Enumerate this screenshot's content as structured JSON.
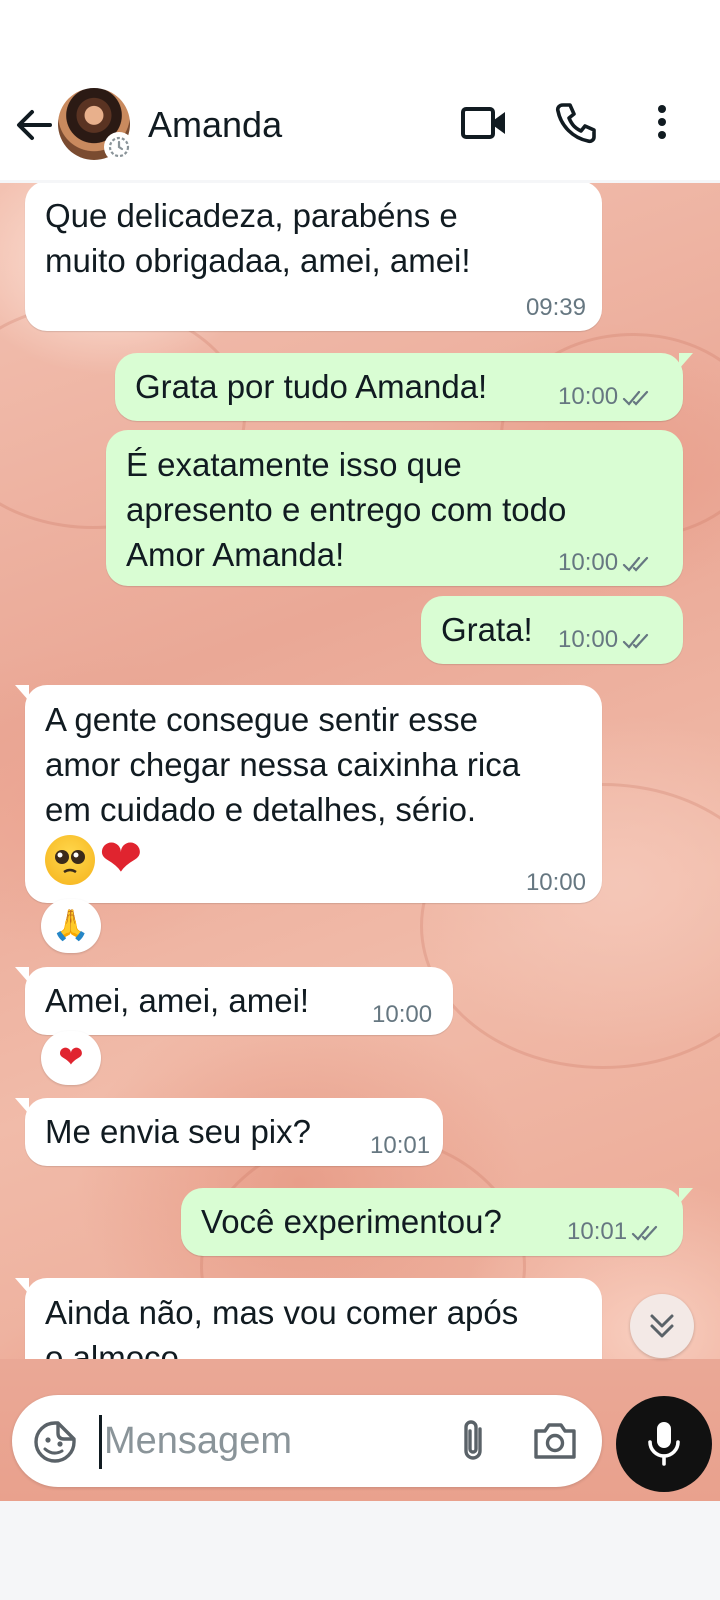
{
  "header": {
    "contact_name": "Amanda",
    "back_icon": "arrow-left-icon",
    "video_icon": "video-camera-icon",
    "call_icon": "phone-icon",
    "menu_icon": "more-vertical-icon"
  },
  "messages": [
    {
      "direction": "in",
      "text": "Que delicadeza, parabéns e\nmuito obrigadaa, amei, amei!",
      "time": "09:39"
    },
    {
      "direction": "out",
      "text": "Grata por tudo Amanda!",
      "time": "10:00",
      "status": "read"
    },
    {
      "direction": "out",
      "text": "É exatamente isso que\napresento e entrego com todo\nAmor Amanda!",
      "time": "10:00",
      "status": "read"
    },
    {
      "direction": "out",
      "text": "Grata!",
      "time": "10:00",
      "status": "read"
    },
    {
      "direction": "in",
      "text": "A gente consegue sentir esse\namor chegar nessa caixinha rica\nem cuidado e detalhes, sério.",
      "emoji": "🥺❤️",
      "time": "10:00",
      "reaction": "🙏"
    },
    {
      "direction": "in",
      "text": "Amei, amei, amei!",
      "time": "10:00",
      "reaction": "❤"
    },
    {
      "direction": "in",
      "text": "Me envia seu pix?",
      "time": "10:01"
    },
    {
      "direction": "out",
      "text": "Você experimentou?",
      "time": "10:01",
      "status": "read"
    },
    {
      "direction": "in",
      "text": "Ainda não, mas vou comer após\no almoço",
      "time": ""
    }
  ],
  "composer": {
    "placeholder": "Mensagem",
    "sticker_icon": "sticker-icon",
    "attach_icon": "paperclip-icon",
    "camera_icon": "camera-icon",
    "mic_icon": "microphone-icon"
  },
  "colors": {
    "incoming_bubble": "#ffffff",
    "outgoing_bubble": "#d9fdd3",
    "timestamp": "#667781",
    "mic_button": "#111111"
  }
}
